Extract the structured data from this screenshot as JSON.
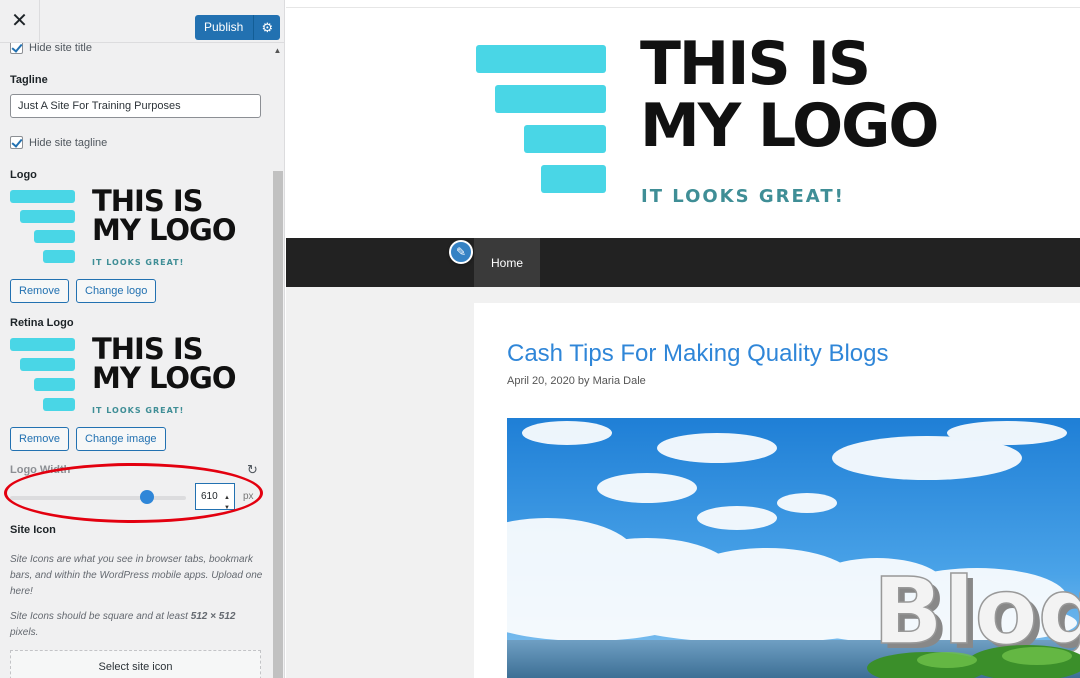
{
  "panel": {
    "close_icon": "close-icon",
    "publish_label": "Publish",
    "publish_settings_icon": "gear-icon",
    "hide_title_label": "Hide site title",
    "tagline_label": "Tagline",
    "tagline_value": "Just A Site For Training Purposes",
    "hide_tagline_label": "Hide site tagline",
    "logo_label": "Logo",
    "remove_label": "Remove",
    "change_logo_label": "Change logo",
    "retina_logo_label": "Retina Logo",
    "change_image_label": "Change image",
    "logo_width_label": "Logo Width",
    "logo_width_value": "610",
    "logo_width_unit": "px",
    "logo_width_fraction": 0.78,
    "site_icon_label": "Site Icon",
    "site_icon_desc1": "Site Icons are what you see in browser tabs, bookmark bars, and within the WordPress mobile apps. Upload one here!",
    "site_icon_desc2_pre": "Site Icons should be square and at least ",
    "site_icon_desc2_bold": "512 × 512",
    "site_icon_desc2_post": " pixels.",
    "select_site_icon_label": "Select site icon"
  },
  "logo": {
    "line1": "THIS IS",
    "line2": "MY LOGO",
    "sub": "IT LOOKS GREAT!",
    "bar_color": "#49d6e6",
    "sub_color": "#3f8e96"
  },
  "preview": {
    "nav_home": "Home",
    "post_title": "Cash Tips For Making Quality Blogs",
    "post_meta": "April 20, 2020 by Maria Dale",
    "image_text": "Blog"
  },
  "colors": {
    "accent": "#2271b1",
    "highlight_circle": "#e3000f",
    "link_blue": "#2f86d8"
  }
}
